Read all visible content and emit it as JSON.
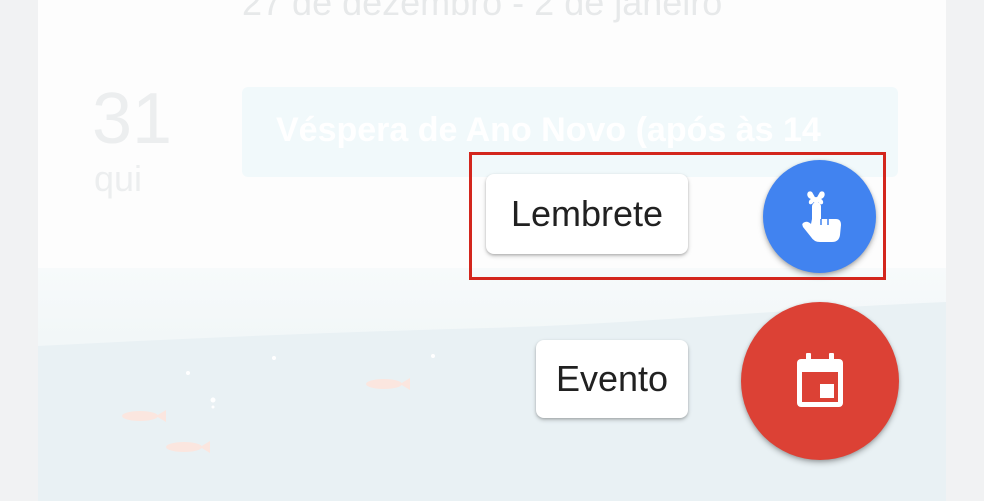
{
  "calendar": {
    "week_range": "27 de dezembro - 2 de janeiro",
    "day_number": "31",
    "day_name": "qui",
    "event_title": "Véspera de Ano Novo (após às 14"
  },
  "fab_menu": {
    "reminder_label": "Lembrete",
    "reminder_icon": "reminder-finger-icon",
    "reminder_color": "#4183f0",
    "event_label": "Evento",
    "event_icon": "calendar-icon",
    "event_color": "#dc4135"
  },
  "annotation": {
    "highlight_color": "#d3261d"
  }
}
